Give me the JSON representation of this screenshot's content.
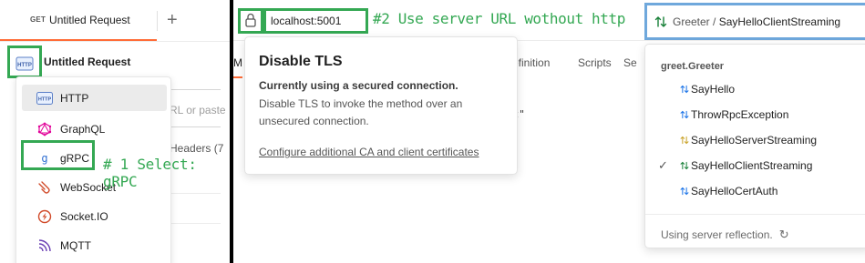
{
  "left": {
    "tab": {
      "method": "GET",
      "title": "Untitled Request"
    },
    "new_tab_label": "+",
    "request_title": "Untitled Request",
    "ghost_text": [
      "RL or paste",
      "Headers (7"
    ],
    "menu_items": [
      {
        "label": "HTTP",
        "icon": "http-icon"
      },
      {
        "label": "GraphQL",
        "icon": "graphql-icon"
      },
      {
        "label": "gRPC",
        "icon": "grpc-icon"
      },
      {
        "label": "WebSocket",
        "icon": "websocket-icon"
      },
      {
        "label": "Socket.IO",
        "icon": "socketio-icon"
      },
      {
        "label": "MQTT",
        "icon": "mqtt-icon"
      }
    ],
    "annotation": "# 1 Select: gRPC"
  },
  "right": {
    "url": "localhost:5001",
    "annotation": "#2 Use server URL wothout http",
    "method_selector": {
      "service": "Greeter",
      "separator": " / ",
      "method": "SayHelloClientStreaming"
    },
    "background_tabs": [
      "M",
      "efinition",
      "Scripts",
      "Se"
    ],
    "background_code": "st\"",
    "tls_popup": {
      "title": "Disable TLS",
      "subtitle": "Currently using a secured connection.",
      "description": "Disable TLS to invoke the method over an unsecured connection.",
      "link": "Configure additional CA and client certificates"
    },
    "dropdown": {
      "header": "greet.Greeter",
      "items": [
        {
          "label": "SayHello",
          "icon_color": "#1a73e8",
          "checked": false
        },
        {
          "label": "ThrowRpcException",
          "icon_color": "#1a73e8",
          "checked": false
        },
        {
          "label": "SayHelloServerStreaming",
          "icon_color": "#c9a227",
          "checked": false
        },
        {
          "label": "SayHelloClientStreaming",
          "icon_color": "#188038",
          "checked": true
        },
        {
          "label": "SayHelloCertAuth",
          "icon_color": "#1a73e8",
          "checked": false
        }
      ],
      "footer": "Using server reflection."
    }
  },
  "colors": {
    "annotation_green": "#34a853",
    "highlight_blue": "#6fa8dc",
    "active_tab_orange": "#ff6c37"
  }
}
